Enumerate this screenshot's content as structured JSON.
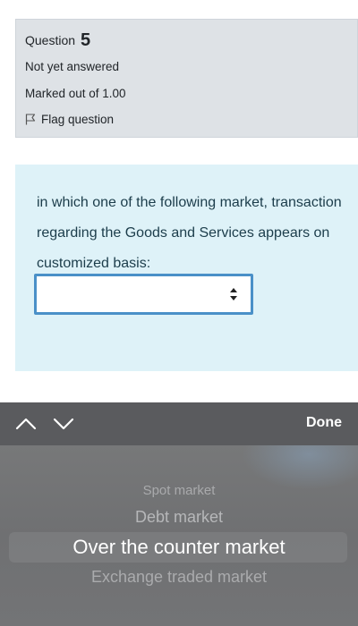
{
  "question": {
    "label": "Question",
    "number": "5",
    "state": "Not yet answered",
    "grade": "Marked out of 1.00",
    "flag_label": "Flag question",
    "text": "in which one of the following market, transaction regarding the Goods and Services appears on customized basis:",
    "select_value": ""
  },
  "toolbar": {
    "done_label": "Done"
  },
  "picker": {
    "options": [
      "Spot market",
      "Debt market",
      "Over the counter market",
      "Exchange traded market"
    ],
    "selected": "Over the counter market"
  },
  "colors": {
    "info_bg": "#dee2e6",
    "question_bg": "#def2f8",
    "select_border": "#4a90c8",
    "toolbar_bg": "#5a5b5e",
    "picker_bg": "#737476"
  },
  "icons": {
    "flag": "flag-icon",
    "select_arrows": "sort-arrows-icon",
    "prev": "chevron-up-icon",
    "next": "chevron-down-icon"
  }
}
